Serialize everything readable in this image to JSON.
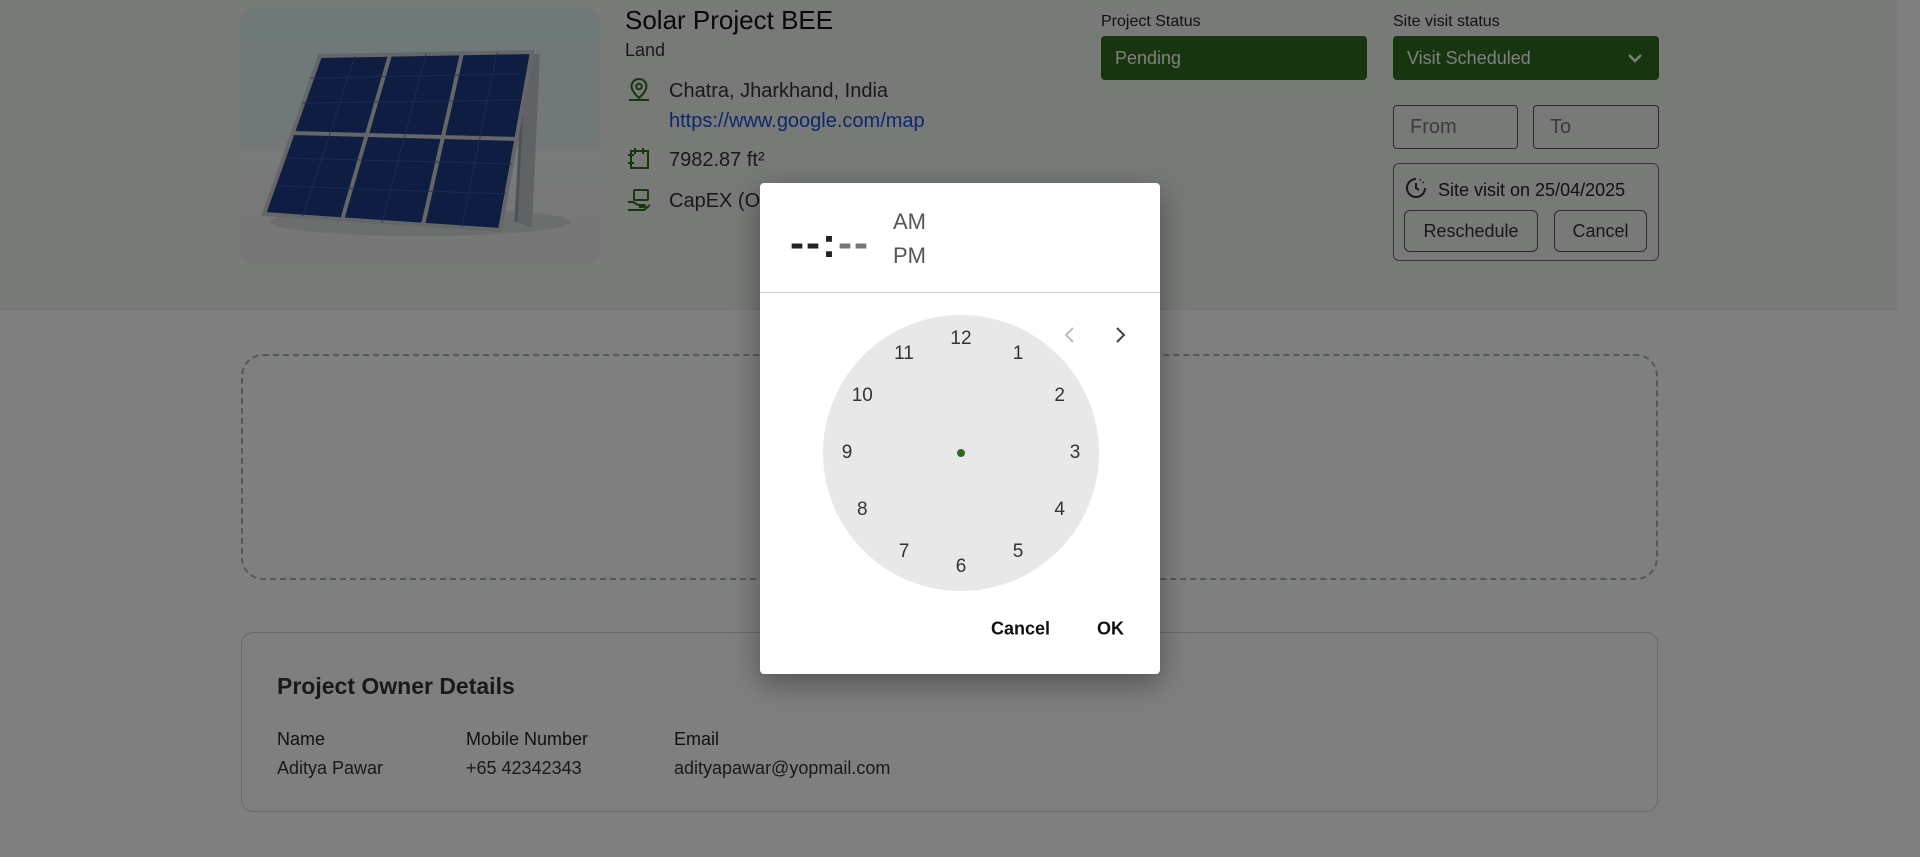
{
  "project": {
    "title": "Solar Project BEE",
    "type": "Land",
    "location": "Chatra, Jharkhand, India",
    "map_link": "https://www.google.com/map",
    "area": "7982.87 ft²",
    "model": "CapEX (O"
  },
  "status": {
    "project_status_label": "Project Status",
    "project_status_value": "Pending",
    "site_visit_label": "Site visit status",
    "site_visit_value": "Visit Scheduled"
  },
  "time_range": {
    "from_placeholder": "From",
    "to_placeholder": "To"
  },
  "visit": {
    "text": "Site visit on 25/04/2025",
    "reschedule_label": "Reschedule",
    "cancel_label": "Cancel"
  },
  "owner": {
    "title": "Project Owner Details",
    "name_label": "Name",
    "name_value": "Aditya Pawar",
    "mobile_label": "Mobile Number",
    "mobile_value": "+65 42342343",
    "email_label": "Email",
    "email_value": "adityapawar@yopmail.com"
  },
  "time_picker": {
    "hour": "--",
    "separator": ":",
    "minute": "--",
    "am": "AM",
    "pm": "PM",
    "clock_numbers": [
      "12",
      "1",
      "2",
      "3",
      "4",
      "5",
      "6",
      "7",
      "8",
      "9",
      "10",
      "11"
    ],
    "cancel_label": "Cancel",
    "ok_label": "OK"
  },
  "colors": {
    "brand_green": "#2f6b1e",
    "link_blue": "#1a4fd6",
    "overlay": "rgba(0,0,0,0.5)"
  }
}
